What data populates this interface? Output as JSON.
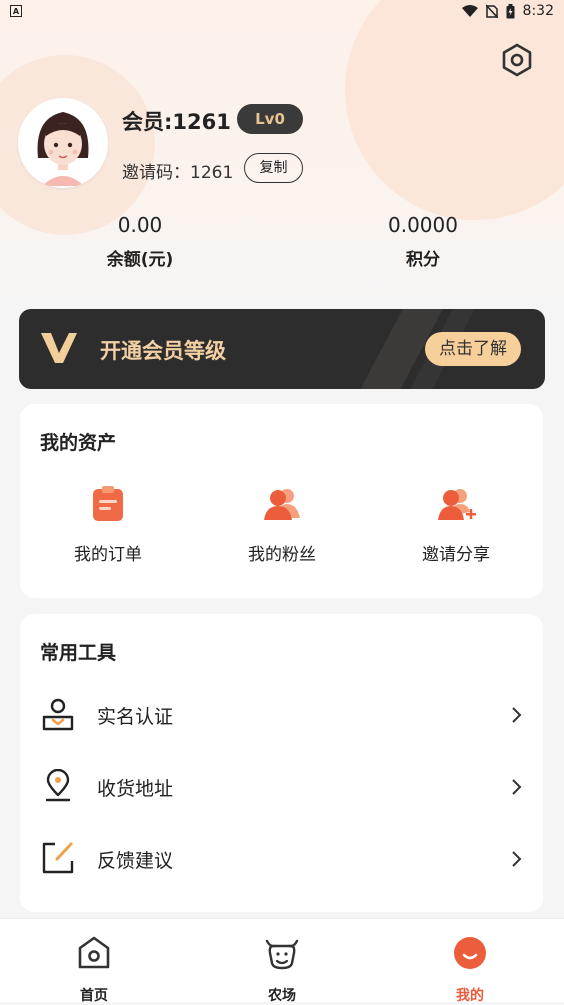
{
  "status_bar": {
    "time": "8:32",
    "left_icon_letter": "A"
  },
  "profile": {
    "member_name": "会员:1261",
    "level_badge": "Lv0",
    "invite_code": "邀请码：1261",
    "copy_label": "复制"
  },
  "stats": [
    {
      "value": "0.00",
      "label": "余额(元)"
    },
    {
      "value": "0.0000",
      "label": "积分"
    }
  ],
  "vip_banner": {
    "title": "开通会员等级",
    "button_label": "点击了解"
  },
  "assets": {
    "title": "我的资产",
    "items": [
      {
        "label": "我的订单",
        "icon": "order-clipboard-icon"
      },
      {
        "label": "我的粉丝",
        "icon": "fans-people-icon"
      },
      {
        "label": "邀请分享",
        "icon": "invite-share-icon"
      }
    ]
  },
  "tools": {
    "title": "常用工具",
    "items": [
      {
        "label": "实名认证",
        "icon": "user-verify-icon"
      },
      {
        "label": "收货地址",
        "icon": "location-pin-icon"
      },
      {
        "label": "反馈建议",
        "icon": "feedback-edit-icon"
      }
    ]
  },
  "tabbar": {
    "items": [
      {
        "label": "首页",
        "icon": "home-icon"
      },
      {
        "label": "农场",
        "icon": "farm-cow-icon"
      },
      {
        "label": "我的",
        "icon": "profile-smile-icon",
        "active": true
      }
    ]
  },
  "colors": {
    "accent": "#e85b3c",
    "gold": "#f7cf9b",
    "vip_bg": "#2e2d2d"
  }
}
